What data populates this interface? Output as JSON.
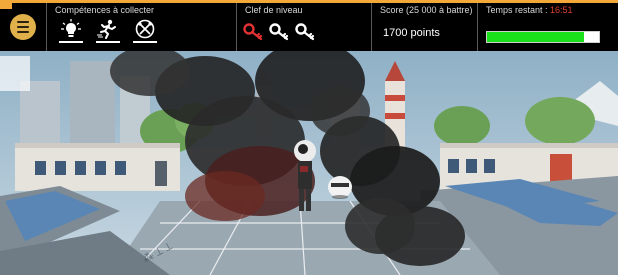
{
  "hud": {
    "skills_title": "Compétences à collecter",
    "skills": [
      {
        "icon": "light-bulb-icon",
        "collected": true
      },
      {
        "icon": "running-man-icon",
        "collected": true
      },
      {
        "icon": "crossed-tools-icon",
        "collected": true
      }
    ],
    "keys_title": "Clef de niveau",
    "keys": [
      {
        "icon": "key-icon",
        "color": "#e03232",
        "collected": true
      },
      {
        "icon": "key-icon",
        "color": "#ffffff",
        "collected": false
      },
      {
        "icon": "key-icon",
        "color": "#ffffff",
        "collected": false
      }
    ],
    "score_title": "Score (25 000 à battre)",
    "score_value": "1700 points",
    "time_label": "Temps restant : ",
    "time_value": "16:51",
    "time_remaining_fraction": 0.87
  },
  "colors": {
    "hud_background": "#000000",
    "menu_button": "#e0b04a",
    "time_bar_fill": "#19e01b",
    "time_value_text": "#e0402e",
    "key_collected": "#e03232"
  }
}
